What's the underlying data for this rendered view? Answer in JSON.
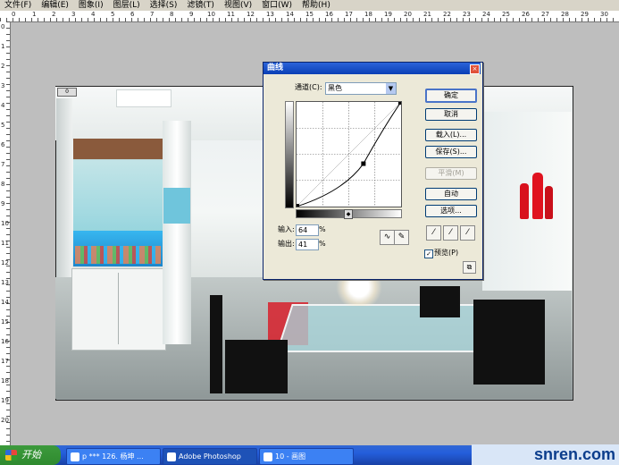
{
  "menubar": {
    "items": [
      "文件(F)",
      "编辑(E)",
      "图象(I)",
      "图层(L)",
      "选择(S)",
      "滤镜(T)",
      "视图(V)",
      "窗口(W)",
      "帮助(H)"
    ]
  },
  "rulers": {
    "top": [
      "0",
      "1",
      "2",
      "3",
      "4",
      "5",
      "6",
      "7",
      "8",
      "9",
      "10",
      "11",
      "12",
      "13",
      "14",
      "15",
      "16",
      "17",
      "18",
      "19",
      "20",
      "21",
      "22",
      "23",
      "24",
      "25",
      "26",
      "27",
      "28",
      "29",
      "30"
    ],
    "left": [
      "0",
      "1",
      "2",
      "3",
      "4",
      "5",
      "6",
      "7",
      "8",
      "9",
      "10",
      "11",
      "12",
      "13",
      "14",
      "15",
      "16",
      "17",
      "18",
      "19",
      "20"
    ]
  },
  "document": {
    "badge": "0"
  },
  "dialog": {
    "title": "曲线",
    "close_icon": "close-icon",
    "channel_label": "通道(C):",
    "channel_value": "黑色",
    "input_label": "输入:",
    "input_value": "64",
    "input_unit": "%",
    "output_label": "输出:",
    "output_value": "41",
    "output_unit": "%",
    "buttons": {
      "ok": "确定",
      "cancel": "取消",
      "load": "载入(L)...",
      "save": "保存(S)...",
      "smooth": "平滑(M)",
      "auto": "自动",
      "options": "选项..."
    },
    "preview_label": "预览(P)",
    "preview_checked": "✓",
    "curve": {
      "points": [
        [
          0,
          0
        ],
        [
          64,
          41
        ],
        [
          100,
          100
        ]
      ],
      "selected_point": [
        64,
        41
      ],
      "grid_divisions": 4
    },
    "colors": {
      "title_bar": "#0a3fb5",
      "dialog_bg": "#ece9d8"
    }
  },
  "taskbar": {
    "start_label": "开始",
    "tasks": [
      "p *** 126. 杨坤 ...",
      "Adobe Photoshop",
      "10 - 画图"
    ],
    "watermark": "snren.com"
  }
}
